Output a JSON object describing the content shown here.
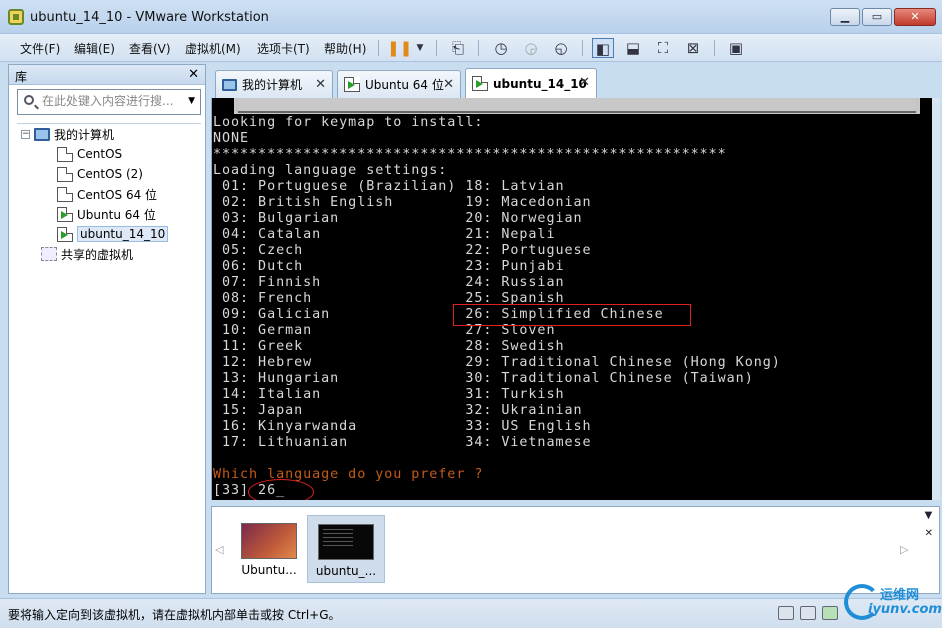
{
  "window": {
    "title": "ubuntu_14_10 - VMware Workstation"
  },
  "menubar": {
    "items": [
      "文件(F)",
      "编辑(E)",
      "查看(V)",
      "虚拟机(M)",
      "选项卡(T)",
      "帮助(H)"
    ]
  },
  "library": {
    "title": "库",
    "search_placeholder": "在此处键入内容进行搜...",
    "tree": {
      "root": "我的计算机",
      "vms": [
        "CentOS",
        "CentOS (2)",
        "CentOS 64 位",
        "Ubuntu 64 位",
        "ubuntu_14_10"
      ],
      "shared": "共享的虚拟机"
    }
  },
  "tabs": [
    "我的计算机",
    "Ubuntu 64 位",
    "ubuntu_14_10"
  ],
  "console": {
    "lines": [
      "Looking for keymap to install:",
      "NONE",
      "*********************************************************",
      "Loading language settings:",
      " 01: Portuguese (Brazilian) 18: Latvian",
      " 02: British English        19: Macedonian",
      " 03: Bulgarian              20: Norwegian",
      " 04: Catalan                21: Nepali",
      " 05: Czech                  22: Portuguese",
      " 06: Dutch                  23: Punjabi",
      " 07: Finnish                24: Russian",
      " 08: French                 25: Spanish",
      " 09: Galician               26: Simplified Chinese",
      " 10: German                 27: Sloven",
      " 11: Greek                  28: Swedish",
      " 12: Hebrew                 29: Traditional Chinese (Hong Kong)",
      " 13: Hungarian              30: Traditional Chinese (Taiwan)",
      " 14: Italian                31: Turkish",
      " 15: Japan                  32: Ukrainian",
      " 16: Kinyarwanda            33: US English",
      " 17: Lithuanian             34: Vietnamese"
    ],
    "prompt": "Which language do you prefer ?",
    "input_line": "[33] 26_"
  },
  "thumbnails": [
    "Ubuntu...",
    "ubuntu_..."
  ],
  "status": {
    "text": "要将输入定向到该虚拟机，请在虚拟机内部单击或按 Ctrl+G。"
  },
  "watermark": {
    "line1": "运维网",
    "line2": "iyunv.com"
  },
  "colors": {
    "console_bg": "#000000",
    "console_text": "#d8d8d8",
    "prompt": "#c35a1a",
    "highlight": "#e02020"
  }
}
